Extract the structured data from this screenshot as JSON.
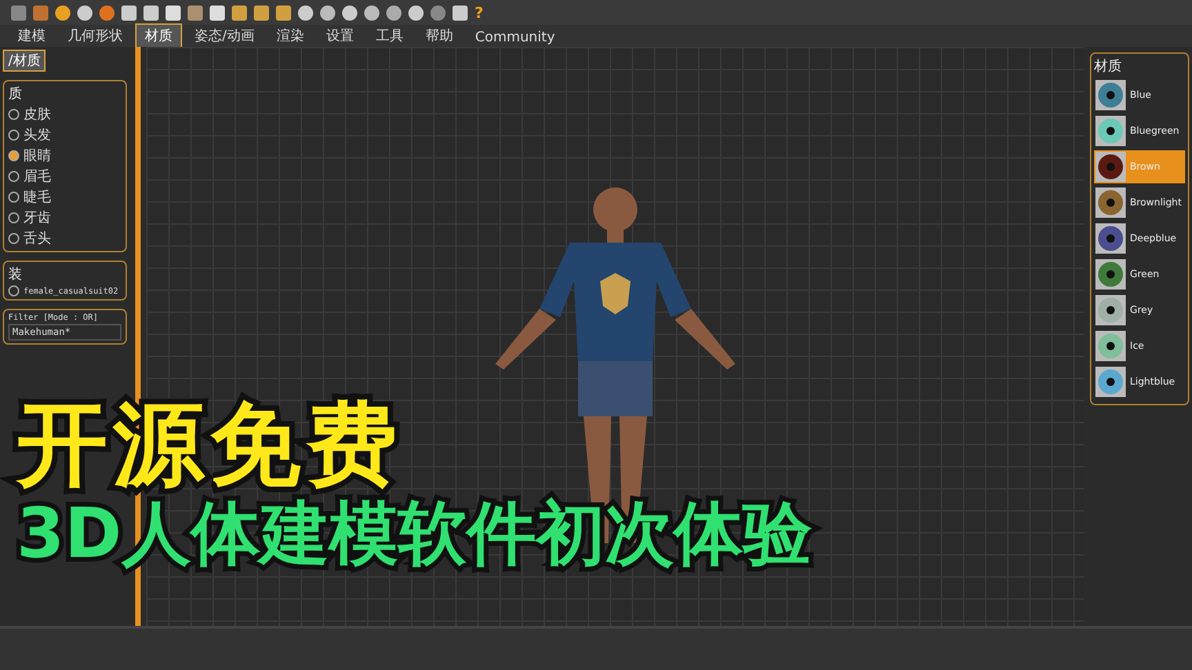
{
  "toolbar": {
    "help": "?"
  },
  "tabs": [
    {
      "label": "建模",
      "selected": false
    },
    {
      "label": "几何形状",
      "selected": false
    },
    {
      "label": "材质",
      "selected": true
    },
    {
      "label": "姿态/动画",
      "selected": false
    },
    {
      "label": "渲染",
      "selected": false
    },
    {
      "label": "设置",
      "selected": false
    },
    {
      "label": "工具",
      "selected": false
    },
    {
      "label": "帮助",
      "selected": false
    },
    {
      "label": "Community",
      "selected": false
    }
  ],
  "subtab": {
    "label": "/材质",
    "selected": true
  },
  "left_panel": {
    "group_1": {
      "title": "质",
      "items": [
        {
          "label": "皮肤",
          "selected": false
        },
        {
          "label": "头发",
          "selected": false
        },
        {
          "label": "眼睛",
          "selected": true
        },
        {
          "label": "眉毛",
          "selected": false
        },
        {
          "label": "睫毛",
          "selected": false
        },
        {
          "label": "牙齿",
          "selected": false
        },
        {
          "label": "舌头",
          "selected": false
        }
      ]
    },
    "group_2": {
      "title": "装",
      "items": [
        {
          "label": "female_casualsuit02",
          "selected": false
        }
      ]
    },
    "filter": {
      "title": "Filter [Mode : OR]",
      "value": "Makehuman*"
    }
  },
  "right_panel": {
    "title": "材质",
    "items": [
      {
        "label": "Blue",
        "color": "#3f7f96",
        "selected": false
      },
      {
        "label": "Bluegreen",
        "color": "#6cc9b6",
        "selected": false
      },
      {
        "label": "Brown",
        "color": "#5a1a12",
        "selected": true
      },
      {
        "label": "Brownlight",
        "color": "#8a6530",
        "selected": false
      },
      {
        "label": "Deepblue",
        "color": "#4a4d8e",
        "selected": false
      },
      {
        "label": "Green",
        "color": "#3f7a3a",
        "selected": false
      },
      {
        "label": "Grey",
        "color": "#9fb0a6",
        "selected": false
      },
      {
        "label": "Ice",
        "color": "#7fbf99",
        "selected": false
      },
      {
        "label": "Lightblue",
        "color": "#5aa8d0",
        "selected": false
      }
    ]
  },
  "overlay": {
    "headline": "开源免费",
    "subtitle": "3D人体建模软件初次体验"
  }
}
